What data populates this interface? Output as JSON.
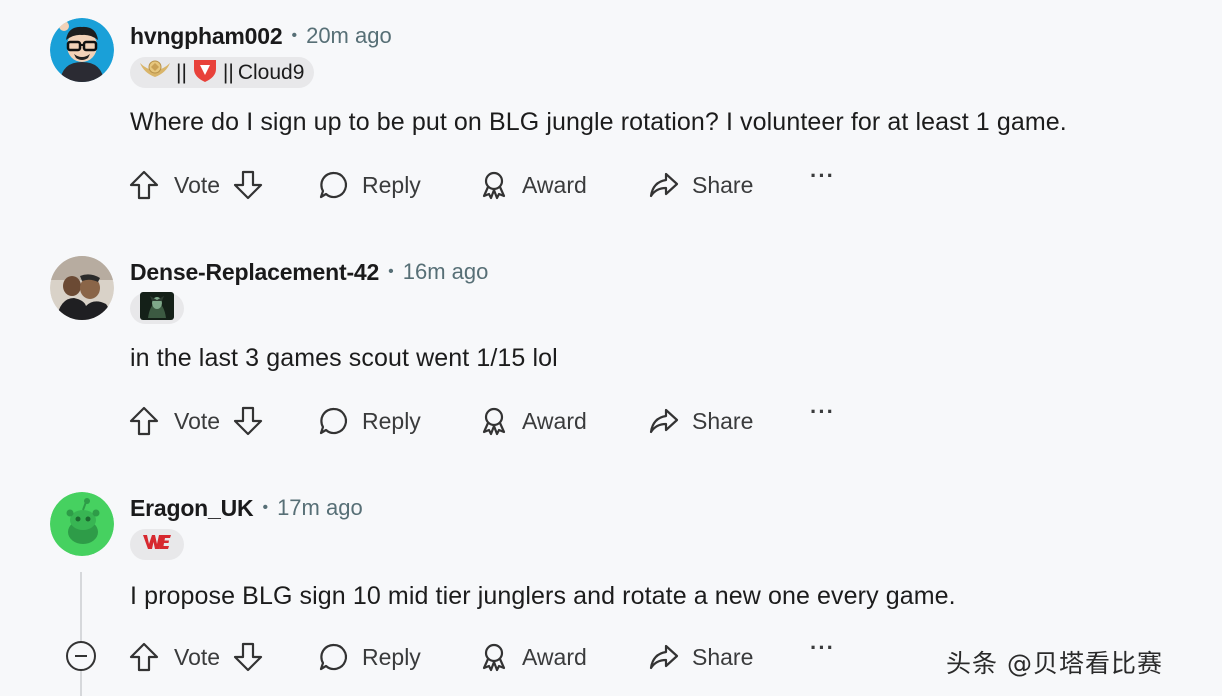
{
  "comments": [
    {
      "username": "hvngpham002",
      "separator": "•",
      "time": "20m ago",
      "flair": {
        "sep1": "||",
        "sep2": "||",
        "text": "Cloud9"
      },
      "body": "Where do I sign up to be put on BLG jungle rotation? I volunteer for at least 1 game.",
      "actions": {
        "vote": "Vote",
        "reply": "Reply",
        "award": "Award",
        "share": "Share",
        "more": "···"
      }
    },
    {
      "username": "Dense-Replacement-42",
      "separator": "•",
      "time": "16m ago",
      "body": "in the last 3 games scout went 1/15 lol",
      "actions": {
        "vote": "Vote",
        "reply": "Reply",
        "award": "Award",
        "share": "Share",
        "more": "···"
      }
    },
    {
      "username": "Eragon_UK",
      "separator": "•",
      "time": "17m ago",
      "body": "I propose BLG sign 10 mid tier junglers and rotate a new one every game.",
      "actions": {
        "vote": "Vote",
        "reply": "Reply",
        "award": "Award",
        "share": "Share",
        "more": "···"
      }
    }
  ],
  "watermark": "头条 @贝塔看比赛",
  "colors": {
    "background": "#f7f8fa",
    "meta": "#576f76",
    "flair_bg": "#e8e8ea",
    "snoo_green": "#46d160"
  }
}
